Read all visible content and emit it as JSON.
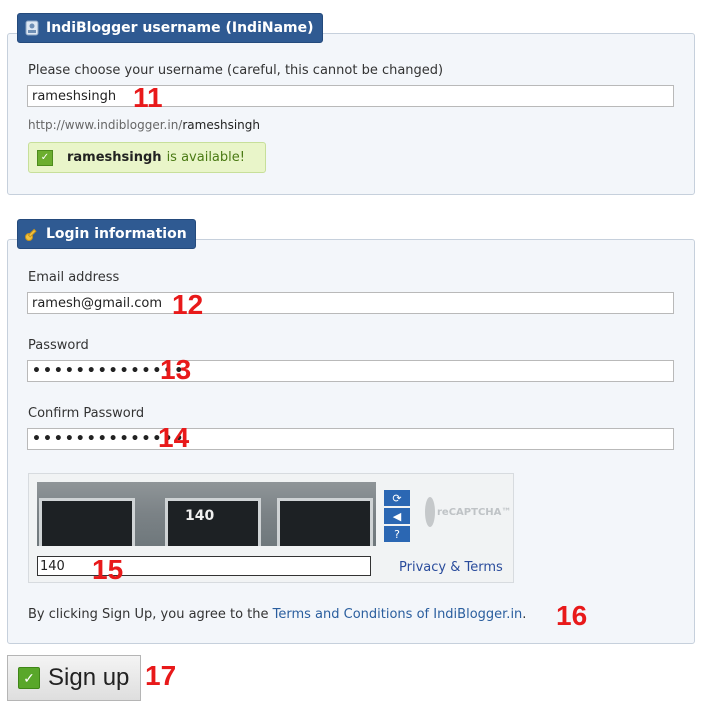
{
  "indiname": {
    "legend": "IndiBlogger username (IndiName)",
    "label": "Please choose your username (careful, this cannot be changed)",
    "username_value": "rameshsingh",
    "url_prefix": "http://www.indiblogger.in/",
    "url_username": "rameshsingh",
    "available_name": "rameshsingh",
    "available_text": "is available!"
  },
  "login": {
    "legend": "Login information",
    "email_label": "Email address",
    "email_value": "ramesh@gmail.com",
    "password_label": "Password",
    "password_value": "••••••••••••••",
    "confirm_label": "Confirm Password",
    "confirm_value": "••••••••••••••"
  },
  "captcha": {
    "image_text": "140",
    "input_value": "140",
    "privacy_link": "Privacy & Terms",
    "logo_text": "reCAPTCHA™",
    "refresh_icon": "refresh-icon",
    "audio_icon": "audio-icon",
    "help_icon": "help-icon"
  },
  "agreement": {
    "prefix": "By clicking Sign Up, you agree to the ",
    "link": "Terms and Conditions of IndiBlogger.in",
    "suffix": "."
  },
  "signup_label": "Sign up",
  "markers": {
    "m11": "11",
    "m12": "12",
    "m13": "13",
    "m14": "14",
    "m15": "15",
    "m16": "16",
    "m17": "17"
  },
  "colors": {
    "legend_bg": "#2f5a92",
    "marker": "#e8191a",
    "link": "#2a5e9e",
    "available_bg": "#e9f5c9"
  }
}
